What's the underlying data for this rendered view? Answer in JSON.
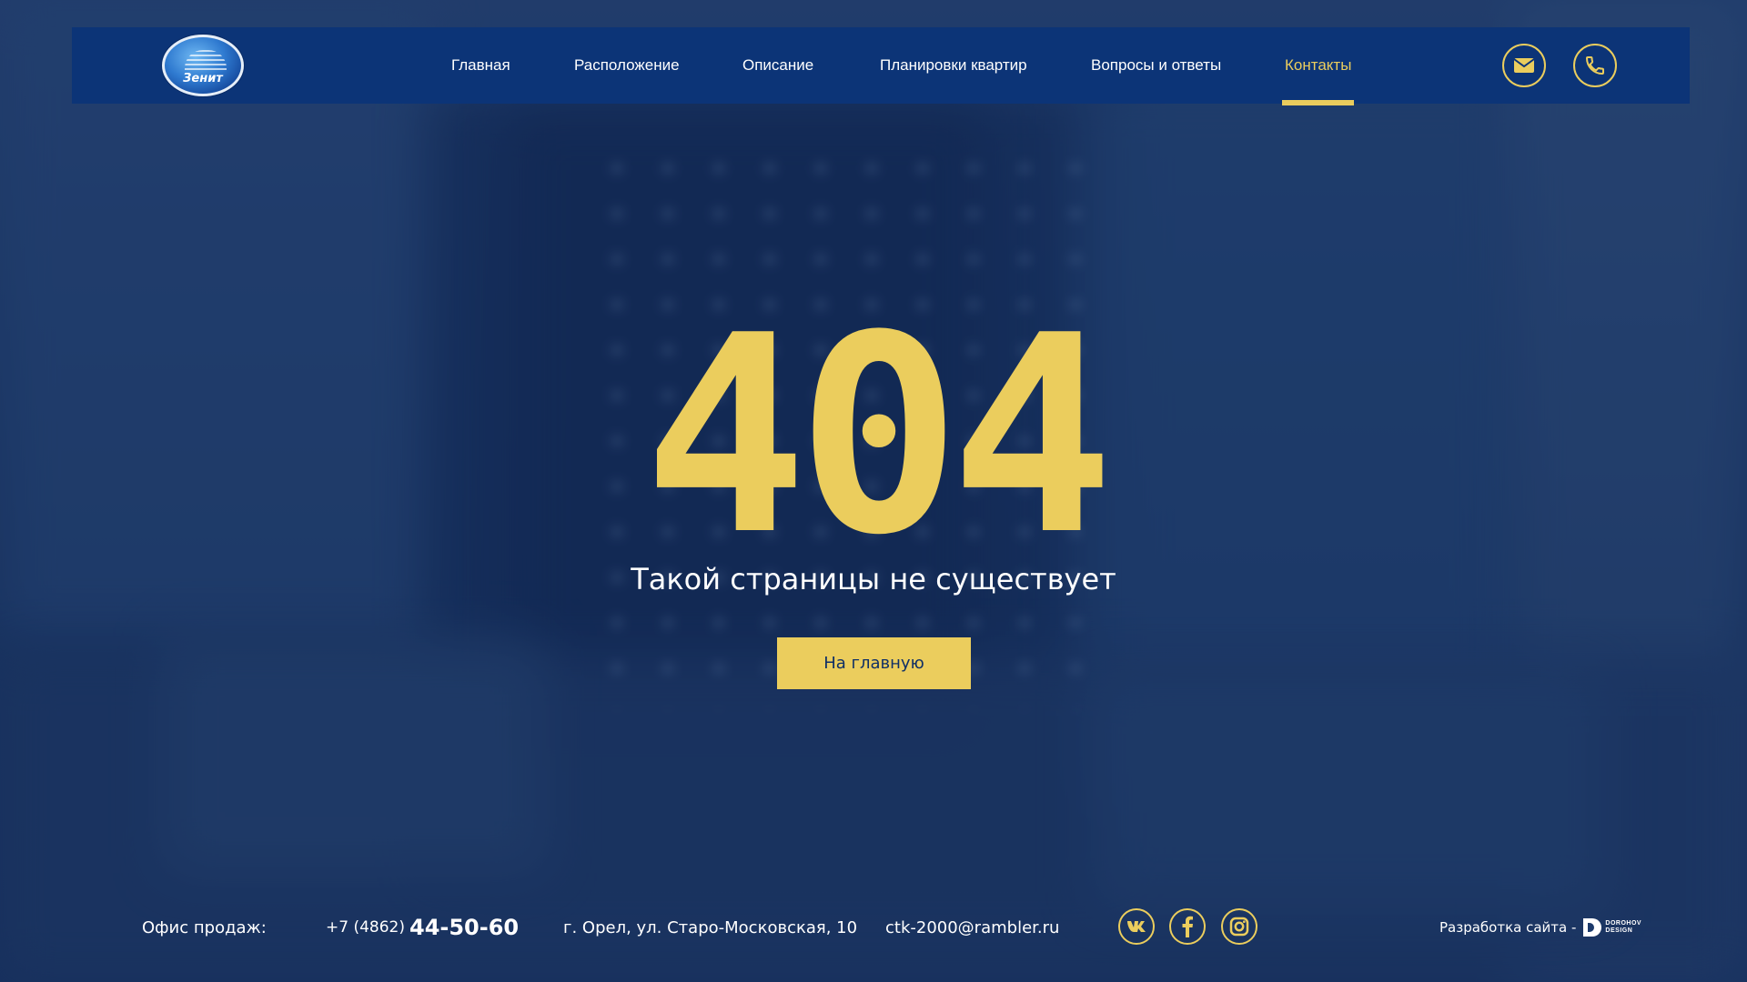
{
  "header": {
    "logo_text": "Зенит",
    "nav": [
      {
        "label": "Главная"
      },
      {
        "label": "Расположение"
      },
      {
        "label": "Описание"
      },
      {
        "label": "Планировки квартир"
      },
      {
        "label": "Вопросы и ответы"
      },
      {
        "label": "Контакты",
        "active": true
      }
    ],
    "icons": {
      "mail": "mail-icon",
      "phone": "phone-icon"
    }
  },
  "main": {
    "code": "404",
    "message": "Такой страницы не существует",
    "button_label": "На главную"
  },
  "footer": {
    "office_label": "Офис продаж:",
    "phone_prefix": "+7 (4862)",
    "phone_main": "44-50-60",
    "address": "г. Орел, ул. Старо-Московская, 10",
    "email": "ctk-2000@rambler.ru",
    "social": [
      "vk-icon",
      "facebook-icon",
      "instagram-icon"
    ],
    "developer_label": "Разработка сайта -",
    "developer_name_line1": "DOROHOV",
    "developer_name_line2": "DESIGN"
  },
  "colors": {
    "accent": "#ebcd5d",
    "header_bg": "#0c3477",
    "background": "#1c3a6b"
  }
}
